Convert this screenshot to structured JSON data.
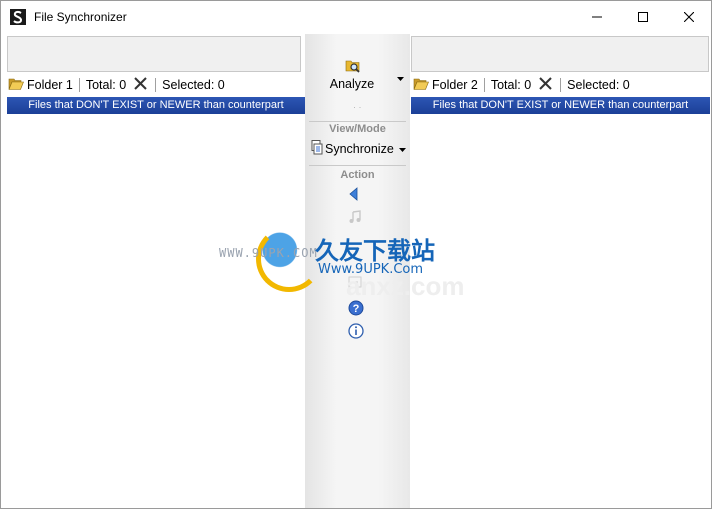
{
  "window": {
    "title": "File Synchronizer"
  },
  "left_pane": {
    "folder_label": "Folder 1",
    "total_label": "Total: 0",
    "selected_label": "Selected: 0",
    "filter_text": "Files that DON'T EXIST or NEWER than counterpart"
  },
  "right_pane": {
    "folder_label": "Folder 2",
    "total_label": "Total: 0",
    "selected_label": "Selected: 0",
    "filter_text": "Files that DON'T EXIST or NEWER than counterpart"
  },
  "middle": {
    "analyze_label": "Analyze",
    "view_mode_heading": "View/Mode",
    "sync_mode_label": "Synchronize",
    "action_heading": "Action"
  },
  "watermark": {
    "title": "久友下载站",
    "url": "Www.9UPK.Com",
    "url_left": "WWW.9UPK.COM",
    "faint_text": "anxz.com"
  },
  "colors": {
    "filter_bar": "#1f449e",
    "folder_yellow": "#e8b830",
    "help_blue": "#3a6fd0"
  }
}
